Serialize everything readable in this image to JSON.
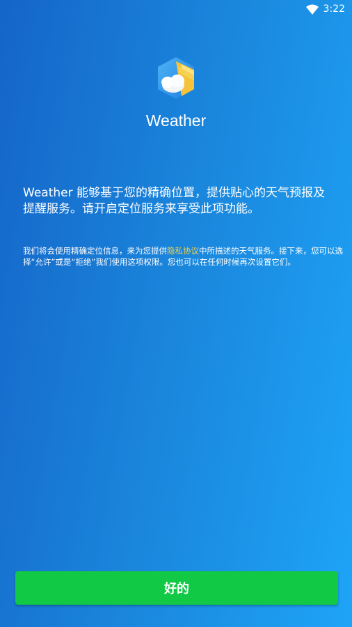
{
  "status_bar": {
    "time": "3:22",
    "wifi_icon": "wifi-icon"
  },
  "app": {
    "name": "Weather",
    "icon": "weather-app-icon"
  },
  "description": {
    "main": "Weather 能够基于您的精确位置，提供贴心的天气预报及提醒服务。请开启定位服务来享受此项功能。",
    "detail_before_link": "我们将会使用精确定位信息，来为您提供",
    "privacy_link": "隐私协议",
    "detail_after_link": "中所描述的天气服务。接下来，您可以选择“允许”或是“拒绝”我们使用这项权限。您也可以在任何时候再次设置它们。"
  },
  "button": {
    "ok_label": "好的"
  },
  "colors": {
    "button_green": "#12c946",
    "link_yellow": "#f6d24a",
    "bg_start": "#1565c8",
    "bg_end": "#1ea4f7"
  }
}
